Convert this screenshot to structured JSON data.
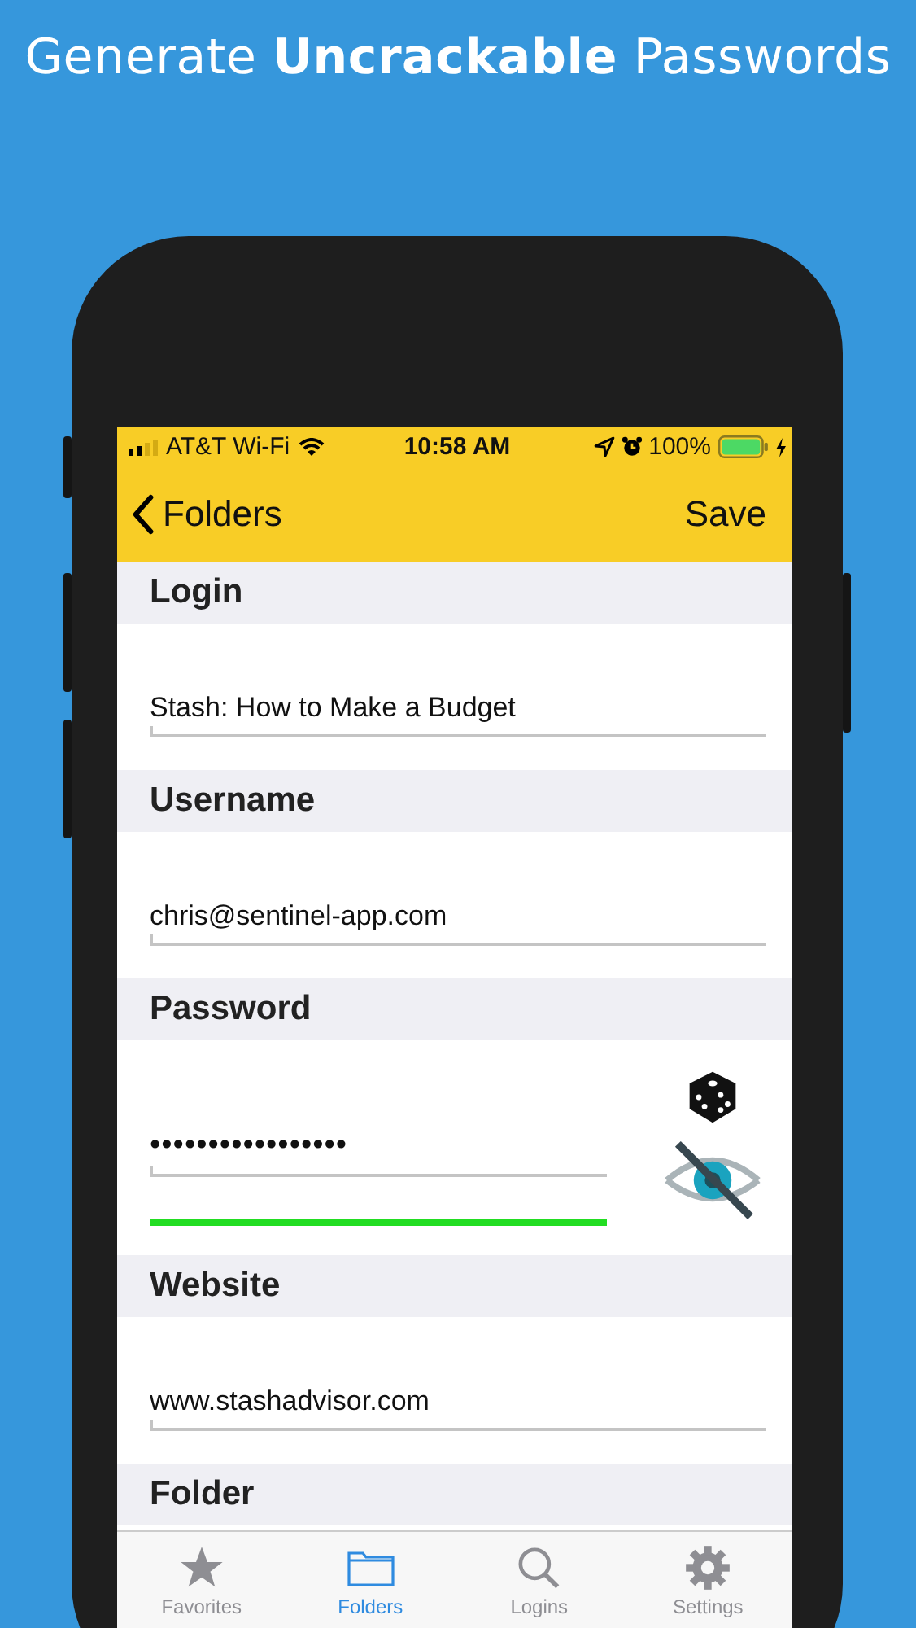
{
  "headline": "Generate **Uncrackable** Passwords",
  "status_bar": {
    "carrier": "AT&T Wi-Fi",
    "time": "10:58 AM",
    "battery": "100%"
  },
  "nav": {
    "back": "Folders",
    "action": "Save"
  },
  "sections": [
    {
      "kind": "text",
      "header": "Login",
      "value": "Stash: How to Make a Budget"
    },
    {
      "kind": "text",
      "header": "Username",
      "value": "chris@sentinel-app.com"
    },
    {
      "kind": "password",
      "header": "Password",
      "value": "•••••••••••••••••",
      "password_visible": false,
      "strength": {
        "level": 1
      }
    },
    {
      "kind": "text",
      "header": "Website",
      "value": "www.stashadvisor.com"
    },
    {
      "kind": "header",
      "header": "Folder"
    }
  ],
  "tabs": [
    {
      "kind": "star",
      "label": "Favorites",
      "selected": false
    },
    {
      "kind": "folder",
      "label": "Folders",
      "selected": true
    },
    {
      "kind": "search",
      "label": "Logins",
      "selected": false
    },
    {
      "kind": "gear",
      "label": "Settings",
      "selected": false
    }
  ]
}
